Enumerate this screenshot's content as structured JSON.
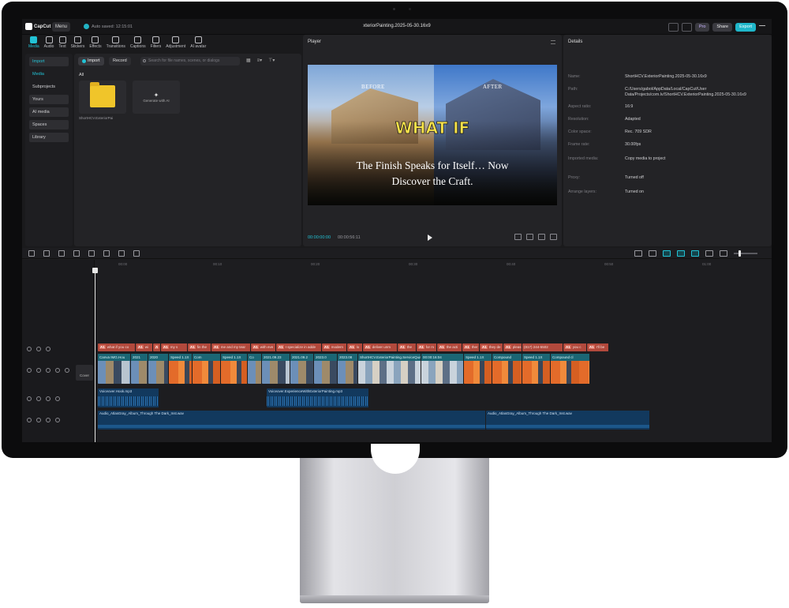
{
  "app": {
    "logo": "CapCut",
    "menu_label": "Menu",
    "autosave": "Auto saved: 12:15:01",
    "doc_title": "xteriorPainting.2025-05-30.16x9"
  },
  "titlebar": {
    "pro": "Pro",
    "share": "Share",
    "export": "Export"
  },
  "toolbar": [
    {
      "label": "Media",
      "icon": "media-icon",
      "active": true
    },
    {
      "label": "Audio",
      "icon": "audio-icon"
    },
    {
      "label": "Text",
      "icon": "text-icon"
    },
    {
      "label": "Stickers",
      "icon": "sticker-icon"
    },
    {
      "label": "Effects",
      "icon": "effects-icon"
    },
    {
      "label": "Transitions",
      "icon": "transitions-icon"
    },
    {
      "label": "Captions",
      "icon": "captions-icon"
    },
    {
      "label": "Filters",
      "icon": "filters-icon"
    },
    {
      "label": "Adjustment",
      "icon": "adjustment-icon"
    },
    {
      "label": "AI avatar",
      "icon": "ai-avatar-icon"
    }
  ],
  "media_sidebar": [
    {
      "label": "Import",
      "style": "sel"
    },
    {
      "label": "Media",
      "style": "media-active"
    },
    {
      "label": "Subprojects",
      "style": ""
    },
    {
      "label": "Yours",
      "style": "box"
    },
    {
      "label": "AI media",
      "style": "box"
    },
    {
      "label": "Spaces",
      "style": "box"
    },
    {
      "label": "Library",
      "style": "box"
    }
  ],
  "media_main": {
    "import_label": "Import",
    "record_label": "Record",
    "search_placeholder": "Search for file names, scenes, or dialogs",
    "all_label": "All",
    "folder_name": "ShortHCV.ExteriorPai",
    "generate_label": "Generate with AI"
  },
  "player": {
    "title": "Player",
    "label_before": "BEFORE",
    "label_after": "AFTER",
    "headline": "WHAT IF",
    "caption_line1": "The Finish Speaks for Itself… Now",
    "caption_line2": "Discover the Craft.",
    "timecode_current": "00:00:00:00",
    "timecode_duration": "00:00:56:11"
  },
  "details": {
    "title": "Details",
    "rows": [
      {
        "key": "Name:",
        "value": "ShortHCV.ExteriorPainting.2025-05-30.16x9"
      },
      {
        "key": "Path:",
        "value": "C:/Users/gabol/AppData/Local/CapCut/User Data/Projects/com.lv/ShortHCV.ExteriorPainting.2025-05-30.16x9"
      },
      {
        "key": "Aspect ratio:",
        "value": "16:9"
      },
      {
        "key": "Resolution:",
        "value": "Adapted"
      },
      {
        "key": "Color space:",
        "value": "Rec. 709 SDR"
      },
      {
        "key": "Frame rate:",
        "value": "30.00fps"
      },
      {
        "key": "Imported media:",
        "value": "Copy media to project"
      },
      {
        "key": "Proxy:",
        "value": "Turned off"
      },
      {
        "key": "Arrange layers:",
        "value": "Turned on"
      }
    ]
  },
  "timeline": {
    "ruler": [
      "00:00",
      "00:10",
      "00:20",
      "00:30",
      "00:40",
      "00:50",
      "01:00"
    ],
    "cover_label": "Cover",
    "text_clips": [
      {
        "tag": "A1",
        "text": "what if you co"
      },
      {
        "tag": "A1",
        "text": "wi"
      },
      {
        "tag": "A",
        "text": ""
      },
      {
        "tag": "A1",
        "text": "my s"
      },
      {
        "tag": "A1",
        "text": "fin the"
      },
      {
        "tag": "A1",
        "text": "me and my tear"
      },
      {
        "tag": "A1",
        "text": "with eve"
      },
      {
        "tag": "A1",
        "text": "I specialize in adde"
      },
      {
        "tag": "A1",
        "text": "modern"
      },
      {
        "tag": "A1",
        "text": "lo"
      },
      {
        "tag": "A1",
        "text": "deliver unm"
      },
      {
        "tag": "A1",
        "text": "the"
      },
      {
        "tag": "A1",
        "text": "for m"
      },
      {
        "tag": "A1",
        "text": "the acti"
      },
      {
        "tag": "A1",
        "text": "ther"
      },
      {
        "tag": "A1",
        "text": "they de"
      },
      {
        "tag": "A1",
        "text": "pleas"
      },
      {
        "tag": "",
        "text": "(817) 244-5502"
      },
      {
        "tag": "A1",
        "text": "you c"
      },
      {
        "tag": "A1",
        "text": "I'll be"
      }
    ],
    "video_clips": [
      {
        "label": "Canva IMG.Hou"
      },
      {
        "label": "2021"
      },
      {
        "label": "2020"
      },
      {
        "label": "Speed 1.1X"
      },
      {
        "label": "Com"
      },
      {
        "label": "Speed 1.1X"
      },
      {
        "label": "Co"
      },
      {
        "label": "2021.09.23"
      },
      {
        "label": "2021.09.2"
      },
      {
        "label": "2023.0"
      },
      {
        "label": "2023.08"
      },
      {
        "label": "ShortHCV.ExteriorPainting.ServiceQuality.16x9.mp4"
      },
      {
        "label": "00:00:16:04"
      },
      {
        "label": "Speed 1.1X"
      },
      {
        "label": "Compound"
      },
      {
        "label": "Speed 1.1X"
      },
      {
        "label": "Compound cl"
      }
    ],
    "voice_clips": [
      {
        "label": "Voiceover.Hook.mp3"
      },
      {
        "label": "Voiceover.ExperienceWithExteriorPainting.mp3"
      }
    ],
    "music_clips": [
      {
        "label": "Audio_AtlasGray_Album_Through The Dark_Inst.wav"
      },
      {
        "label": "Audio_AtlasGray_Album_Through The Dark_Inst.wav"
      }
    ]
  }
}
